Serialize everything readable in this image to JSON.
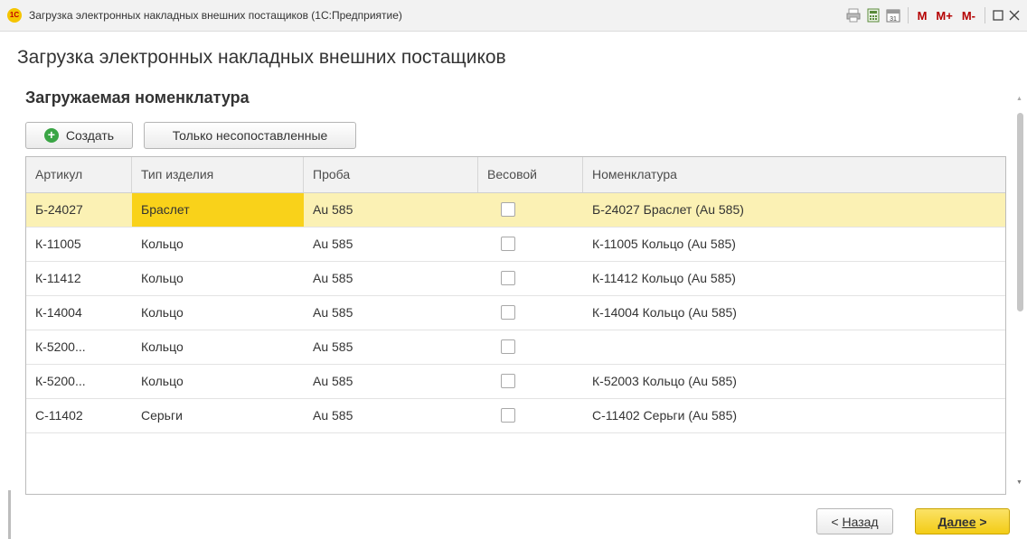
{
  "window": {
    "title": "Загрузка электронных накладных внешних постащиков  (1С:Предприятие)",
    "logo_text": "1С",
    "toolbar": {
      "m": "M",
      "m_plus": "M+",
      "m_minus": "M-"
    }
  },
  "form": {
    "title": "Загрузка электронных накладных внешних постащиков",
    "section_title": "Загружаемая номенклатура",
    "buttons": {
      "create": "Создать",
      "only_unmatched": "Только несопоставленные"
    }
  },
  "table": {
    "columns": [
      "Артикул",
      "Тип изделия",
      "Проба",
      "Весовой",
      "Номенклатура"
    ],
    "rows": [
      {
        "article": "Б-24027",
        "type": "Браслет",
        "assay": "Au 585",
        "weight": false,
        "nomenclature": "Б-24027 Браслет (Au 585)",
        "selected": true
      },
      {
        "article": "К-11005",
        "type": "Кольцо",
        "assay": "Au 585",
        "weight": false,
        "nomenclature": "К-11005 Кольцо (Au 585)",
        "selected": false
      },
      {
        "article": "К-11412",
        "type": "Кольцо",
        "assay": "Au 585",
        "weight": false,
        "nomenclature": "К-11412 Кольцо (Au 585)",
        "selected": false
      },
      {
        "article": "К-14004",
        "type": "Кольцо",
        "assay": "Au 585",
        "weight": false,
        "nomenclature": "К-14004 Кольцо (Au 585)",
        "selected": false
      },
      {
        "article": "К-5200...",
        "type": "Кольцо",
        "assay": "Au 585",
        "weight": false,
        "nomenclature": "",
        "selected": false
      },
      {
        "article": "К-5200...",
        "type": "Кольцо",
        "assay": "Au 585",
        "weight": false,
        "nomenclature": "К-52003 Кольцо (Au 585)",
        "selected": false
      },
      {
        "article": "С-11402",
        "type": "Серьги",
        "assay": "Au 585",
        "weight": false,
        "nomenclature": "С-11402 Серьги (Au 585)",
        "selected": false
      }
    ]
  },
  "footer": {
    "back_prefix": "< ",
    "back_label": "Назад",
    "next_label": "Далее",
    "next_suffix": " >"
  },
  "colors": {
    "selected_row": "#fbf1b4",
    "active_cell": "#f9d21a",
    "primary_button": "#f3cc16",
    "create_icon": "#3aa545",
    "memory_buttons": "#b50000"
  },
  "icons": {
    "print": "printer-icon",
    "calculator": "calculator-icon",
    "calendar": "calendar-icon",
    "maximize": "maximize-icon",
    "close": "close-icon",
    "create": "plus-circle-icon"
  }
}
